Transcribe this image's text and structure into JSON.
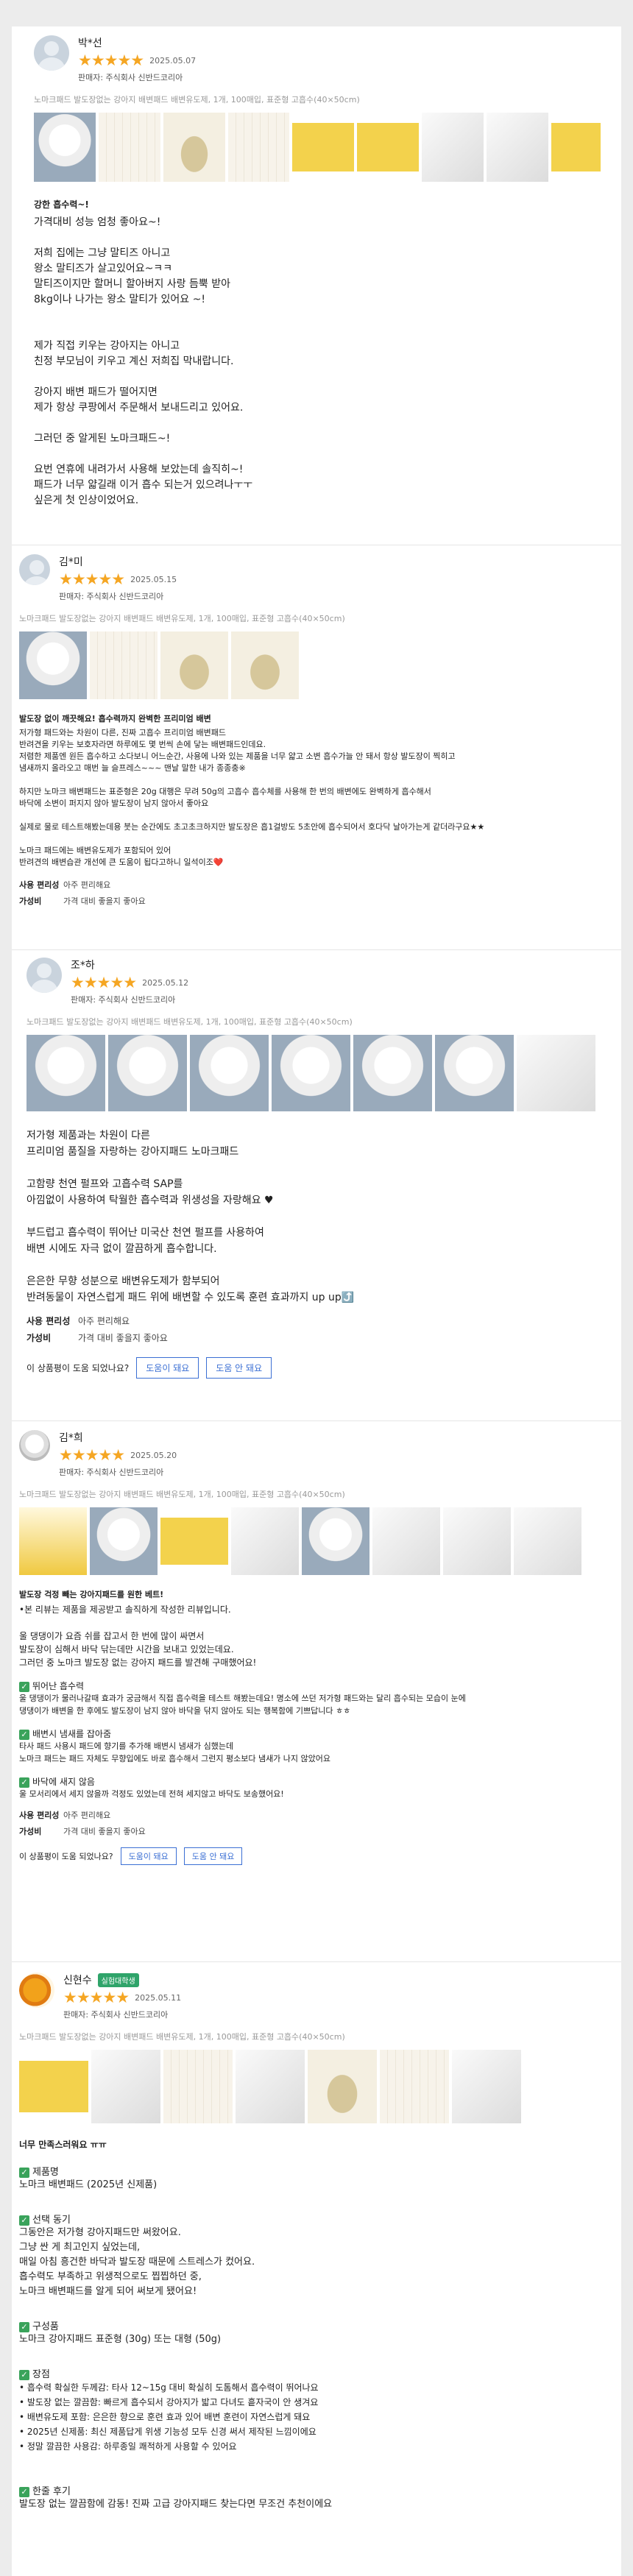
{
  "reviews": [
    {
      "name": "박*선",
      "date": "2025.05.07",
      "seller": "판매자: 주식회사 신반드코리아",
      "option": "노마크패드 발도장없는 강아지 배변패드 배변유도제, 1개, 100매입, 표준형 고흡수(40×50cm)",
      "stars": "★★★★★",
      "title": "강한 흡수력~!",
      "body": "가격대비 성능 엄청 좋아요~!\n\n저희 집에는 그냥 말티즈 아니고\n왕소 말티즈가 살고있어요~ㅋㅋ\n말티즈이지만 할머니 할아버지 사랑 듬뿍 받아\n8kg이나 나가는 왕소 말티가 있어요 ~!\n\n\n제가 직접 키우는 강아지는 아니고\n친정 부모님이 키우고 계신 저희집 막내랍니다.\n\n강아지 배변 패드가 떨어지면\n제가 항상 쿠팡에서 주문해서 보내드리고 있어요.\n\n그러던 중 알게된 노마크패드~!\n\n요번 연휴에 내려가서 사용해 보았는데 솔직히~!\n패드가 너무 얇길래 이거 흡수 되는거 있으려나ㅜㅜ\n싶은게 첫 인상이었어요."
    },
    {
      "name": "김*미",
      "date": "2025.05.15",
      "seller": "판매자: 주식회사 신반드코리아",
      "option": "노마크패드 발도장없는 강아지 배변패드 배변유도제, 1개, 100매입, 표준형 고흡수(40×50cm)",
      "stars": "★★★★★",
      "title": "발도장 없이 깨끗해요! 흡수력까지 완벽한 프리미엄 배변",
      "body": "저가형 패드와는 차원이 다른, 진짜 고흡수 프리미엄 배변패드\n반려견을 키우는 보호자라면 하루에도 몇 번씩 손에 닿는 배변패드인데요.\n저렴한 제품엔 원든 흡수하고 소다보니 어느순간, 사용에 나와 있는 제품을 너무 얇고 소변 흡수가늘 안 돼서 항상 발도장이 찍히고\n냄새까지 올라오고 매번 늘 슬프레스~~~ 맨날 말한 내가 종종충※\n\n하지만 노마크 배변패드는 표준형은 20g 대행은 무려 50g의 고흡수 흡수체를 사용해 한 번의 배변에도 완벽하게 흡수해서\n바닥에 소변이 퍼지지 않아 발도장이 남지 않아서 좋아요\n\n실제로 물로 테스트해봤는데용 붓는 순간에도 초고초크하지만 발도장은 흡1걸방도 5초안에 흡수되어서 호다닥 날아가는게 같더라구요★★\n\n노마크 패드에는 배변유도제가 포함되어 있어\n반려견의 배변습관 개선에 큰 도움이 됩다고하니 일석이조❤️",
      "kv": [
        {
          "k": "사용 편리성",
          "v": "아주 편리해요"
        },
        {
          "k": "가성비",
          "v": "가격 대비 좋을지 좋아요"
        }
      ]
    },
    {
      "name": "조*하",
      "date": "2025.05.12",
      "seller": "판매자: 주식회사 신반드코리아",
      "option": "노마크패드 발도장없는 강아지 배변패드 배변유도제, 1개, 100매입, 표준형 고흡수(40×50cm)",
      "stars": "★★★★★",
      "body": "저가형 제품과는 차원이 다른\n프리미엄 품질을 자랑하는 강아지패드 노마크패드\n\n고함량 천연 펄프와 고흡수력 SAP를\n아낌없이 사용하여 탁월한 흡수력과 위생성을 자랑해요 ♥\n\n부드럽고 흡수력이 뛰어난 미국산 천연 펄프를 사용하여\n배변 시에도 자극 없이 깔끔하게 흡수합니다.\n\n은은한 무향 성분으로 배변유도제가 함부되어\n반려동물이 자연스럽게 패드 위에 배변할 수 있도록 훈련 효과까지 up up⤴️",
      "kv": [
        {
          "k": "사용 편리성",
          "v": "아주 편리해요"
        },
        {
          "k": "가성비",
          "v": "가격 대비 좋을지 좋아요"
        }
      ],
      "helpful": "이 상품평이 도움 되었나요?",
      "yes": "도움이 돼요",
      "no": "도움 안 돼요"
    },
    {
      "name": "김*희",
      "date": "2025.05.20",
      "seller": "판매자: 주식회사 신반드코리아",
      "option": "노마크패드 발도장없는 강아지 배변패드 배변유도제, 1개, 100매입, 표준형 고흡수(40×50cm)",
      "stars": "★★★★★",
      "title": "발도장 걱정 빼는 강아지패드를 원한 베트!",
      "body": "•본 리뷰는 제품을 제공받고 솔직하게 작성한 리뷰입니다.\n\n울 댕댕이가 요즘 쉬를 잡고서 한 번에 많이 싸면서\n발도장이 심해서 바닥 닦는데만 시간을 보내고 있었는데요.\n그러던 중 노마크 발도장 없는 강아지 패드를 발견해 구매했어요!",
      "sections": [
        {
          "t": "뛰어난 흡수력",
          "b": "울 댕댕이가 물러나갈때 효과가 궁금해서 직접 흡수력을 테스트 해봤는데요! 명소에 쓰던 저가형 패드와는 달리 흡수되는 모습이 눈에\n댕댕이가 배변을 한 후에도 발도장이 남지 않아 바닥을 닦지 않아도 되는 행복함에 기쁘답니다 ㅎㅎ"
        },
        {
          "t": "배변시 냄새를 잡아줌",
          "b": "타사 패드 사용시 패드에 향기를 추가해 배변시 냄새가 심했는데\n노마크 패드는 패드 자체도 무향입에도 바로 흡수해서 그런지 평소보다 냄새가 나지 않았어요"
        },
        {
          "t": "바닥에 새지 않음",
          "b": "울 모서리에서 세지 않을까 걱정도 있었는데 전혀 세지않고 바닥도 보송했어요!"
        }
      ],
      "kv": [
        {
          "k": "사용 편리성",
          "v": "아주 편리해요"
        },
        {
          "k": "가성비",
          "v": "가격 대비 좋을지 좋아요"
        }
      ],
      "helpful": "이 상품평이 도움 되었나요?",
      "yes": "도움이 돼요",
      "no": "도움 안 돼요"
    },
    {
      "name": "신현수",
      "badge": "실험대학생",
      "date": "2025.05.11",
      "seller": "판매자: 주식회사 신반드코리아",
      "option": "노마크패드 발도장없는 강아지 배변패드 배변유도제, 1개, 100매입, 표준형 고흡수(40×50cm)",
      "stars": "★★★★★",
      "title": "너무 만족스러워요 ㅠㅠ",
      "sections": [
        {
          "t": "제품명",
          "b": "노마크 배변패드 (2025년 신제품)"
        },
        {
          "t": "선택 동기",
          "b": "그동안은 저가형 강아지패드만 써왔어요.\n그냥 싼 게 최고인지 싶었는데,\n매일 아침 흥건한 바닥과 발도장 때문에 스트레스가 컸어요.\n흡수력도 부족하고 위생적으로도 찝찝하던 중,\n노마크 배변패드를 알게 되어 써보게 됐어요!"
        },
        {
          "t": "구성품",
          "b": "노마크 강아지패드 표준형 (30g) 또는 대형 (50g)"
        },
        {
          "t": "장점",
          "b": "• 흡수력 확실한 두께감: 타사 12~15g 대비 확실히 도톰해서 흡수력이 뛰어나요\n• 발도장 없는 깔끔함: 빠르게 흡수되서 강아지가 밟고 다녀도 흩자국이 안 생겨요\n• 배변유도제 포함: 은은한 향으로 훈련 효과 있어 배변 훈련이 자연스럽게 돼요\n• 2025년 신제품: 최신 제품답게 위생 기능성 모두 신경 써서 제작된 느낌이에요\n• 정말 깔끔한 사용감: 하루종일 쾌적하게 사용할 수 있어요"
        },
        {
          "t": "한줄 후기",
          "b": "발도장 없는 깔끔함에 감동! 진짜 고급 강아지패드 찾는다면 무조건 추천이에요"
        }
      ]
    }
  ]
}
